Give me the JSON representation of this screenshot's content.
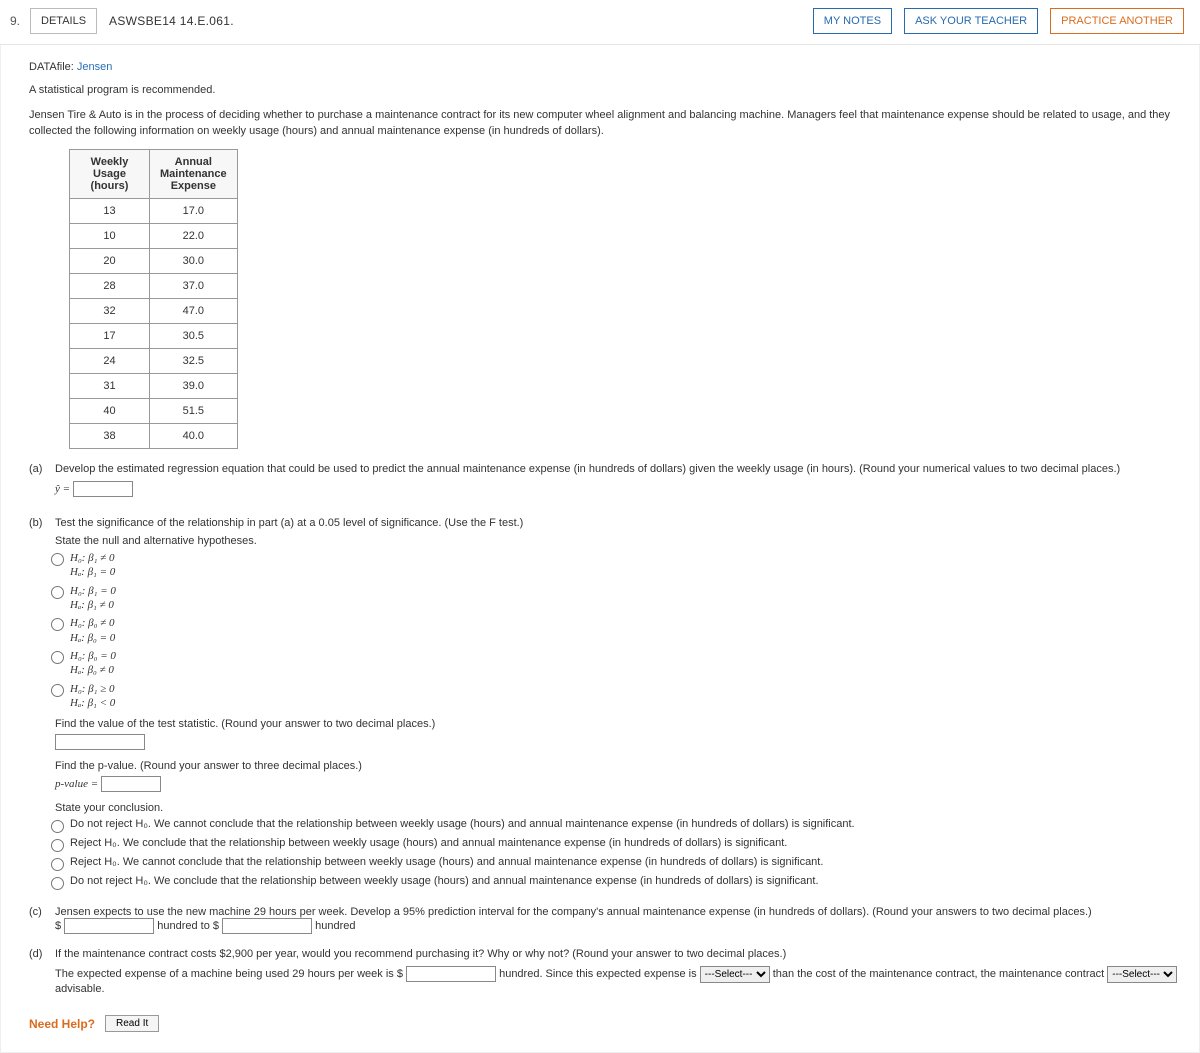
{
  "number": "9.",
  "buttons": {
    "details": "DETAILS",
    "mynotes": "MY NOTES",
    "ask": "ASK YOUR TEACHER",
    "practice": "PRACTICE ANOTHER"
  },
  "source": "ASWSBE14 14.E.061.",
  "datafile_label": "DATAfile:",
  "datafile_name": "Jensen",
  "rec": "A statistical program is recommended.",
  "prompt": "Jensen Tire & Auto is in the process of deciding whether to purchase a maintenance contract for its new computer wheel alignment and balancing machine. Managers feel that maintenance expense should be related to usage, and they collected the following information on weekly usage (hours) and annual maintenance expense (in hundreds of dollars).",
  "table": {
    "h1": "Weekly Usage (hours)",
    "h2": "Annual Maintenance Expense",
    "rows": [
      {
        "u": "13",
        "e": "17.0"
      },
      {
        "u": "10",
        "e": "22.0"
      },
      {
        "u": "20",
        "e": "30.0"
      },
      {
        "u": "28",
        "e": "37.0"
      },
      {
        "u": "32",
        "e": "47.0"
      },
      {
        "u": "17",
        "e": "30.5"
      },
      {
        "u": "24",
        "e": "32.5"
      },
      {
        "u": "31",
        "e": "39.0"
      },
      {
        "u": "40",
        "e": "51.5"
      },
      {
        "u": "38",
        "e": "40.0"
      }
    ]
  },
  "a": {
    "ltr": "(a)",
    "text": "Develop the estimated regression equation that could be used to predict the annual maintenance expense (in hundreds of dollars) given the weekly usage (in hours). (Round your numerical values to two decimal places.)",
    "yhat": "ŷ ="
  },
  "b": {
    "ltr": "(b)",
    "text1": "Test the significance of the relationship in part (a) at a 0.05 level of significance. (Use the F test.)",
    "state": "State the null and alternative hypotheses.",
    "opts": [
      {
        "h0": "H₀: β₁ ≠ 0",
        "ha": "Hₐ: β₁ = 0"
      },
      {
        "h0": "H₀: β₁ = 0",
        "ha": "Hₐ: β₁ ≠ 0"
      },
      {
        "h0": "H₀: β₀ ≠ 0",
        "ha": "Hₐ: β₀ = 0"
      },
      {
        "h0": "H₀: β₀ = 0",
        "ha": "Hₐ: β₀ ≠ 0"
      },
      {
        "h0": "H₀: β₁ ≥ 0",
        "ha": "Hₐ: β₁ < 0"
      }
    ],
    "teststat": "Find the value of the test statistic. (Round your answer to two decimal places.)",
    "pval_prompt": "Find the p-value. (Round your answer to three decimal places.)",
    "pval_label": "p-value =",
    "conc": "State your conclusion.",
    "conclusions": [
      "Do not reject H₀. We cannot conclude that the relationship between weekly usage (hours) and annual maintenance expense (in hundreds of dollars) is significant.",
      "Reject H₀. We conclude that the relationship between weekly usage (hours) and annual maintenance expense (in hundreds of dollars) is significant.",
      "Reject H₀. We cannot conclude that the relationship between weekly usage (hours) and annual maintenance expense (in hundreds of dollars) is significant.",
      "Do not reject H₀. We conclude that the relationship between weekly usage (hours) and annual maintenance expense (in hundreds of dollars) is significant."
    ]
  },
  "c": {
    "ltr": "(c)",
    "text": "Jensen expects to use the new machine 29 hours per week. Develop a 95% prediction interval for the company's annual maintenance expense (in hundreds of dollars). (Round your answers to two decimal places.)",
    "dollar": "$",
    "to": "hundred to $",
    "hundred": "hundred"
  },
  "d": {
    "ltr": "(d)",
    "text": "If the maintenance contract costs $2,900 per year, would you recommend purchasing it? Why or why not? (Round your answer to two decimal places.)",
    "line_a": "The expected expense of a machine being used 29 hours per week is $",
    "line_b": "hundred. Since this expected expense is",
    "line_c": "than the cost of the maintenance contract, the maintenance contract",
    "line_d": "advisable.",
    "select_ph": "---Select---"
  },
  "help": {
    "label": "Need Help?",
    "read": "Read It"
  }
}
